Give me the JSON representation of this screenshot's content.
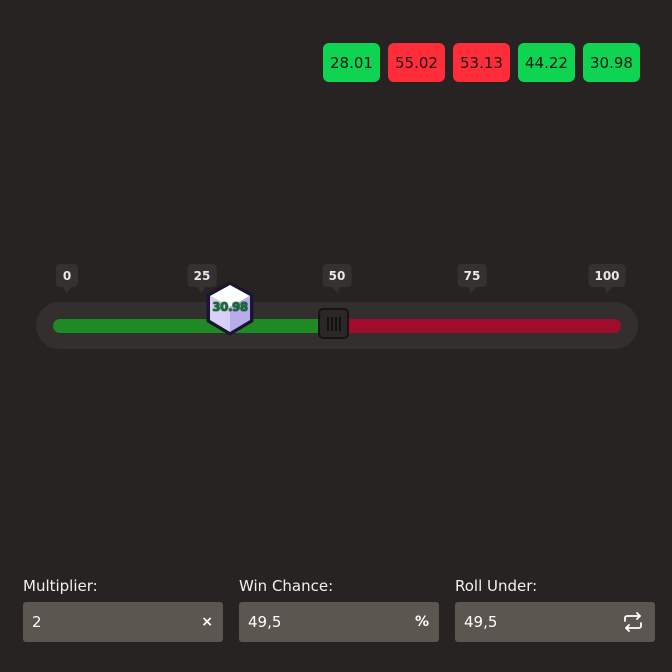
{
  "history": [
    {
      "value": "28.01",
      "result": "win"
    },
    {
      "value": "55.02",
      "result": "loss"
    },
    {
      "value": "53.13",
      "result": "loss"
    },
    {
      "value": "44.22",
      "result": "win"
    },
    {
      "value": "30.98",
      "result": "win"
    }
  ],
  "slider": {
    "ticks": [
      "0",
      "25",
      "50",
      "75",
      "100"
    ],
    "roll_under_percent": 49.5,
    "rolled_value": "30.98",
    "colors": {
      "win": "#1e8a23",
      "loss": "#a10b2c"
    }
  },
  "inputs": {
    "multiplier": {
      "label": "Multiplier:",
      "value": "2",
      "suffix": "×"
    },
    "win_chance": {
      "label": "Win Chance:",
      "value": "49,5",
      "suffix": "%"
    },
    "roll_under": {
      "label": "Roll Under:",
      "value": "49,5",
      "icon": "swap-icon"
    }
  }
}
